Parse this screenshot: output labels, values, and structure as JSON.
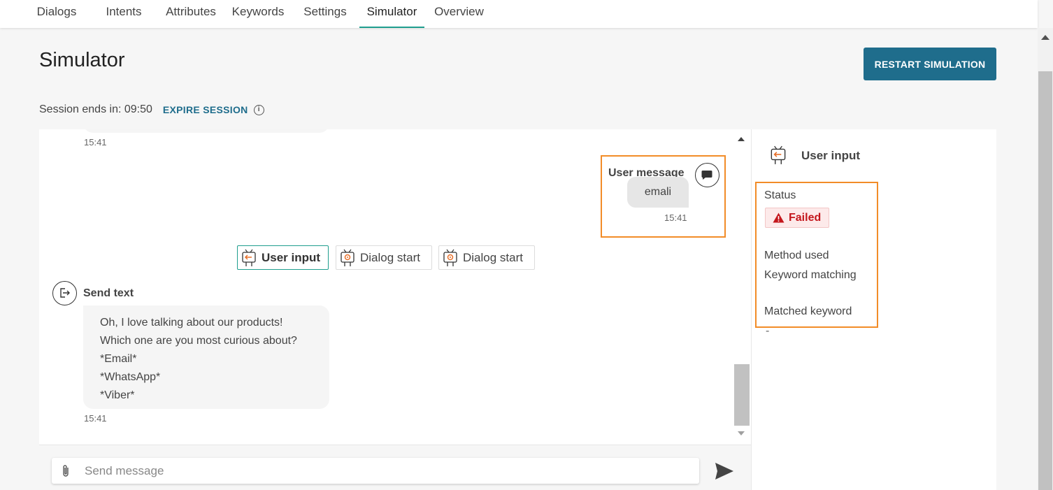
{
  "nav": {
    "tabs": [
      "Dialogs",
      "Intents",
      "Attributes",
      "Keywords",
      "Settings",
      "Simulator",
      "Overview"
    ],
    "active": "Simulator"
  },
  "page": {
    "title": "Simulator",
    "restart_label": "RESTART SIMULATION",
    "session_label": "Session ends in: 09:50",
    "expire_label": "EXPIRE SESSION"
  },
  "chat": {
    "prev_timestamp": "15:41",
    "user_message": {
      "label": "User message",
      "text": "emali",
      "timestamp": "15:41"
    },
    "nodes": [
      {
        "label": "User input",
        "active": true
      },
      {
        "label": "Dialog start",
        "active": false
      },
      {
        "label": "Dialog start",
        "active": false
      }
    ],
    "send_text": {
      "label": "Send text",
      "lines": [
        "Oh, I love talking about our products!",
        "Which one are you most curious about?",
        "*Email*",
        "*WhatsApp*",
        "*Viber*"
      ],
      "timestamp": "15:41"
    },
    "composer_placeholder": "Send message"
  },
  "side_panel": {
    "title": "User input",
    "status_label": "Status",
    "status_value": "Failed",
    "method_label": "Method used",
    "method_value": "Keyword matching",
    "keyword_label": "Matched keyword",
    "keyword_value": "-"
  },
  "colors": {
    "accent_teal": "#1f9e8e",
    "primary_blue": "#1f6d8c",
    "highlight_orange": "#f28c28",
    "error_red": "#c4161c"
  }
}
